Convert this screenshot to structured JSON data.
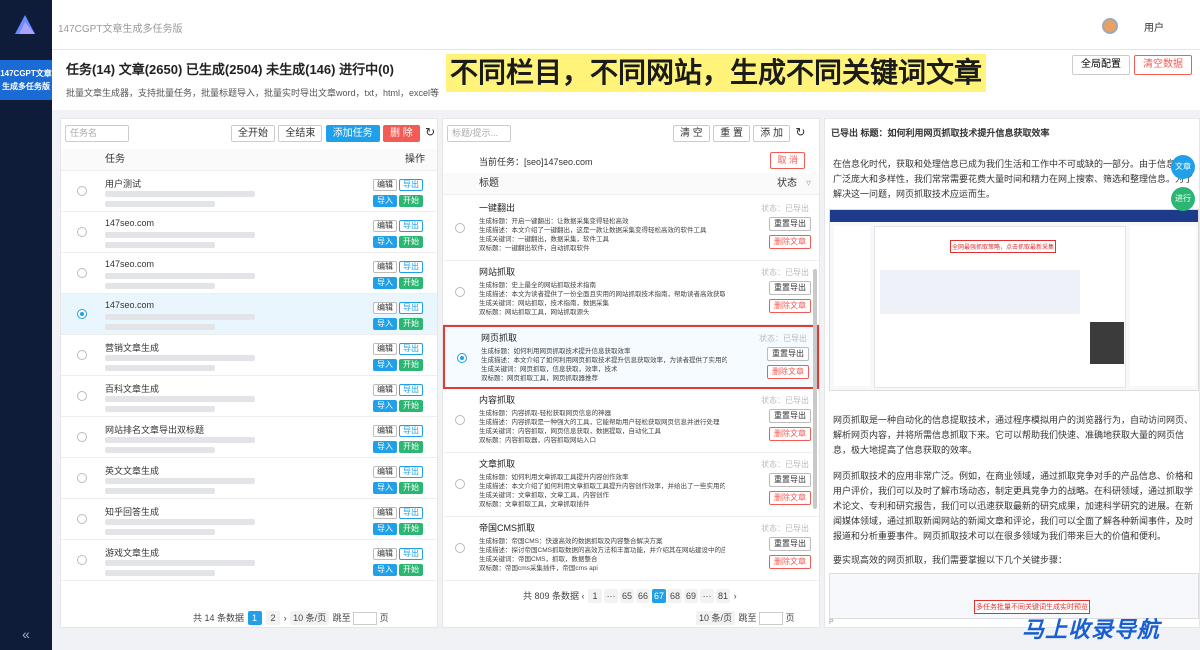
{
  "app": {
    "tab_title": "147CGPT文章生成多任务版",
    "side_label_1": "147CGPT文章",
    "side_label_2": "生成多任务版",
    "collapse": "«",
    "user": "用户"
  },
  "header": {
    "stats": "任务(14) 文章(2650) 已生成(2504) 未生成(146) 进行中(0)",
    "desc": "批量文章生成器，支持批量任务，批量标题导入，批量实时导出文章word，txt，html，excel等",
    "banner": "不同栏目，不同网站，生成不同关键词文章",
    "global_config": "全局配置",
    "clear_data": "清空数据"
  },
  "tasks": {
    "search_placeholder": "任务名",
    "start_all": "全开始",
    "end_all": "全结束",
    "add_task": "添加任务",
    "delete": "删 除",
    "col_task": "任务",
    "col_op": "操作",
    "rows": [
      {
        "name": "用户测试",
        "checked": false
      },
      {
        "name": "147seo.com",
        "checked": false
      },
      {
        "name": "147seo.com",
        "checked": false
      },
      {
        "name": "147seo.com",
        "checked": true
      },
      {
        "name": "营销文章生成",
        "checked": false
      },
      {
        "name": "百科文章生成",
        "checked": false
      },
      {
        "name": "网站排名文章导出双标题",
        "checked": false
      },
      {
        "name": "英文文章生成",
        "checked": false
      },
      {
        "name": "知乎回答生成",
        "checked": false
      },
      {
        "name": "游戏文章生成",
        "checked": false
      }
    ],
    "btn_edit": "编辑",
    "btn_export": "导出",
    "btn_import": "导入",
    "btn_start": "开始",
    "pager": {
      "total": "共 14 条数据",
      "pages": [
        "1",
        "2"
      ],
      "page_size": "10 条/页",
      "jump": "跳至",
      "page_unit": "页"
    }
  },
  "keywords": {
    "search_placeholder": "标题/提示...",
    "clear": "清 空",
    "reset": "重 置",
    "add": "添 加",
    "current_task": "当前任务：[seo]147seo.com",
    "cancel": "取 消",
    "col_title": "标题",
    "col_state": "状态",
    "items": [
      {
        "title": "一键翻出",
        "lines": [
          "生成标题：开启一键翻出：让数据采集变得轻松高效",
          "生成描述：本文介绍了一键翻出，这是一款让数据采集变得轻松高效的软件工具",
          "生成关键词：一键翻出，数据采集，软件工具",
          "双标题：一键翻出软件，自动抓取软件"
        ],
        "selected": false
      },
      {
        "title": "网站抓取",
        "lines": [
          "生成标题：史上最全的网站抓取技术指南",
          "生成描述：本文为读者提供了一份全面且实用的网站抓取技术指南，帮助读者高效获取所需",
          "生成关键词：网站抓取，技术指南，数据采集",
          "双标题：网站抓取工具，网站抓取源头"
        ],
        "selected": false
      },
      {
        "title": "网页抓取",
        "lines": [
          "生成标题：如何利用网页抓取技术提升信息获取效率",
          "生成描述：本文介绍了如何利用网页抓取技术提升信息获取效率，为读者提供了实用的经",
          "生成关键词：网页抓取，信息获取，效率，技术",
          "双标题：网页抓取工具，网页抓取器推荐"
        ],
        "selected": true
      },
      {
        "title": "内容抓取",
        "lines": [
          "生成标题：内容抓取-轻松获取网页信息的神器",
          "生成描述：内容抓取是一种强大的工具，它能帮助用户轻松获取网页信息并进行处理",
          "生成关键词：内容抓取，网页信息获取，数据提取，自动化工具",
          "双标题：内容抓取器，内容抓取网站入口"
        ],
        "selected": false
      },
      {
        "title": "文章抓取",
        "lines": [
          "生成标题：如何利用文章抓取工具提升内容创作效率",
          "生成描述：本文介绍了如何利用文章抓取工具提升内容创作效率，并给出了一些实用的建",
          "生成关键词：文章抓取，文章工具，内容创作",
          "双标题：文章抓取工具，文章抓取插件"
        ],
        "selected": false
      },
      {
        "title": "帝国CMS抓取",
        "lines": [
          "生成标题：帝国CMS：快速高效的数据抓取及内容整合解决方案",
          "生成描述：探讨帝国CMS抓取数据的高效方法和丰富功能，并介绍其在网站建设中的应用",
          "生成关键词：帝国CMS，抓取，数据整合",
          "双标题：帝国cms采集插件，帝国cms api"
        ],
        "selected": false
      }
    ],
    "state_label": "状态：已导出",
    "btn_export": "重置导出",
    "btn_delete": "删除文章",
    "pager": {
      "total": "共 809 条数据",
      "pages": [
        "1",
        "···",
        "65",
        "66",
        "67",
        "68",
        "69",
        "···",
        "81"
      ],
      "current": "67",
      "page_size": "10 条/页",
      "jump": "跳至",
      "page_unit": "页"
    }
  },
  "article": {
    "title": "已导出 标题：如何利用网页抓取技术提升信息获取效率",
    "p1": "在信息化时代，获取和处理信息已成为我们生活和工作中不可或缺的一部分。由于信息资源广泛庞大和多样性，我们常常需要花费大量时间和精力在网上搜索、筛选和整理信息。为了解决这一问题，网页抓取技术应运而生。",
    "p2": "网页抓取是一种自动化的信息提取技术，通过程序模拟用户的浏览器行为，自动访问网页、解析网页内容，并将所需信息抓取下来。它可以帮助我们快速、准确地获取大量的网页信息，极大地提高了信息获取的效率。",
    "p3": "网页抓取技术的应用非常广泛。例如，在商业领域，通过抓取竞争对手的产品信息、价格和用户评价，我们可以及时了解市场动态，制定更具竞争力的战略。在科研领域，通过抓取学术论文、专利和研究报告，我们可以迅速获取最新的研究成果，加速科学研究的进展。在新闻媒体领域，通过抓取新闻网站的新闻文章和评论，我们可以全面了解各种新闻事件，及时报道和分析重要事件。网页抓取技术可以在很多领域为我们带来巨大的价值和便利。",
    "p4": "要实现高效的网页抓取，我们需要掌握以下几个关键步骤：",
    "shot_label1": "全网最强抓取策略，点击抓取最新采集",
    "shot_label2": "多任务批量不同关键词生成实时预览",
    "float_article": "文章",
    "float_progress": "进行",
    "page_marker": "P"
  },
  "watermark": "马上收录导航",
  "colors": {
    "accent": "#1fa0e8",
    "danger": "#f25c54",
    "success": "#2bb673",
    "sidebar": "#0e1c3a"
  }
}
